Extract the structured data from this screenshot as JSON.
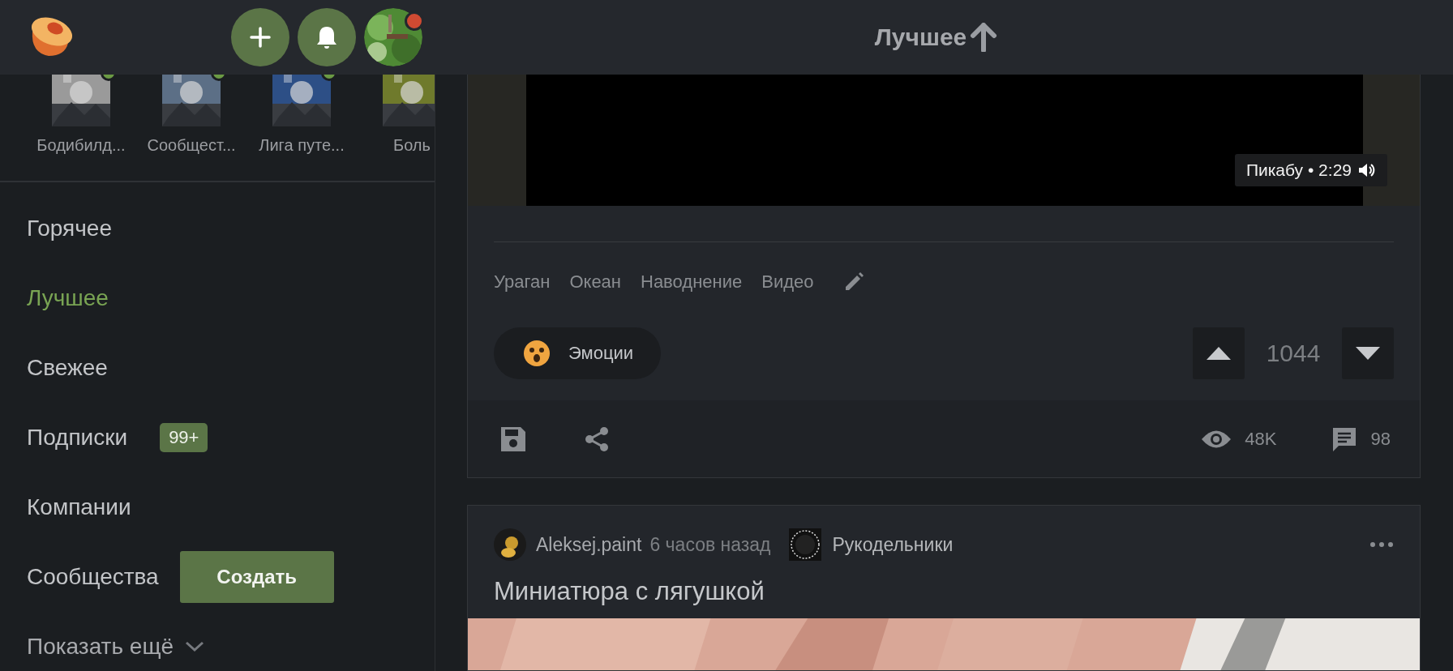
{
  "header": {
    "has_unread_notifications": true,
    "page_title": "Лучшее"
  },
  "stories": [
    {
      "label": "Бодибилд...",
      "online": true
    },
    {
      "label": "Сообщест...",
      "online": true
    },
    {
      "label": "Лига путе...",
      "online": true
    },
    {
      "label": "Боль"
    }
  ],
  "nav": [
    {
      "label": "Горячее",
      "selected": false
    },
    {
      "label": "Лучшее",
      "selected": true
    },
    {
      "label": "Свежее",
      "selected": false
    },
    {
      "label": "Подписки",
      "selected": false,
      "badge": "99+"
    },
    {
      "label": "Компании",
      "selected": false
    },
    {
      "label": "Сообщества",
      "selected": false,
      "action": "Создать"
    }
  ],
  "show_more": "Показать ещё",
  "post": {
    "video_caption": "Пикабу • 2:29",
    "tags": [
      "Ураган",
      "Океан",
      "Наводнение",
      "Видео"
    ],
    "emotions_label": "Эмоции",
    "rating": "1044",
    "views": "48K",
    "comments": "98"
  },
  "next_post": {
    "author": "Aleksej.paint",
    "time": "6 часов назад",
    "community": "Рукодельники",
    "title": "Миниатюра с лягушкой"
  }
}
